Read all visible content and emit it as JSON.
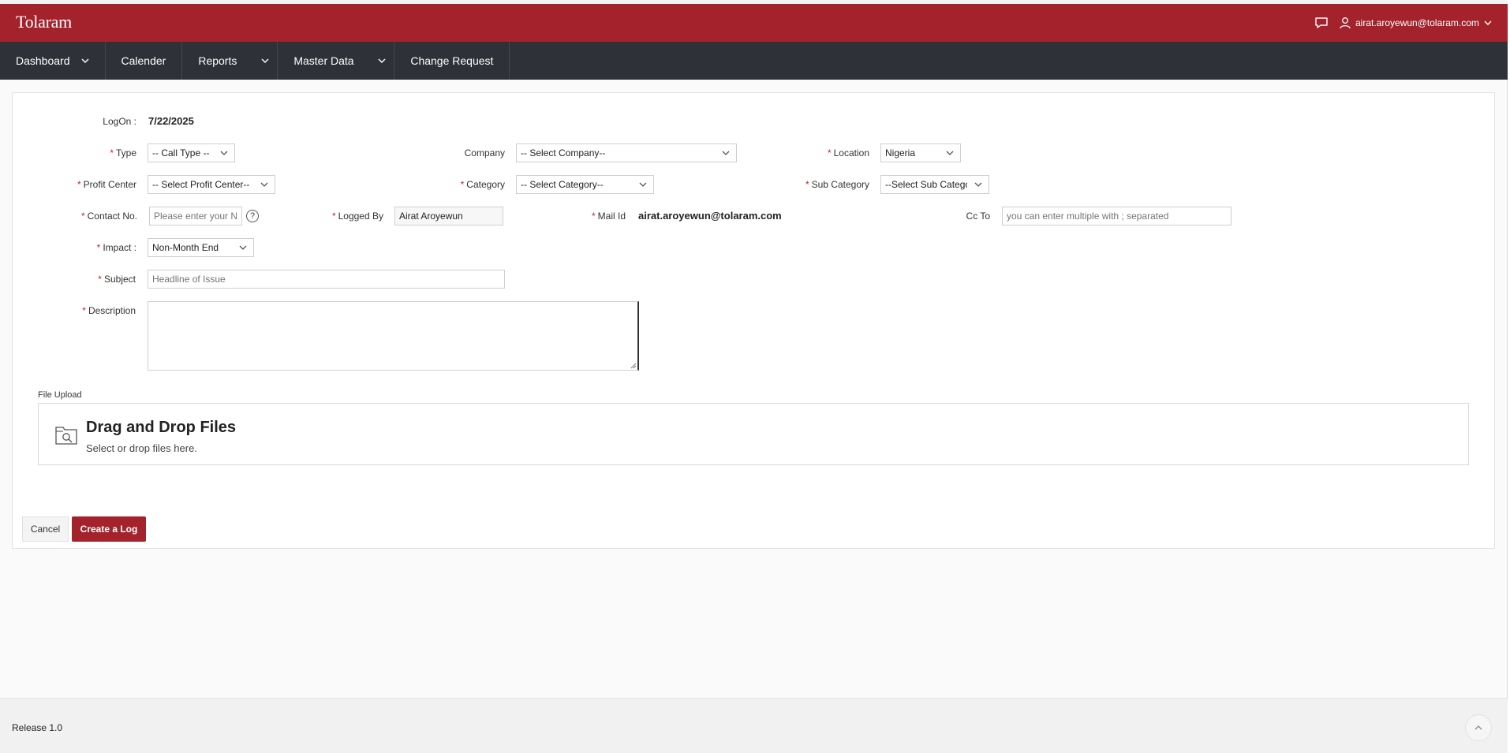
{
  "app": {
    "title": "Tolaram"
  },
  "header": {
    "user_email": "airat.aroyewun@tolaram.com"
  },
  "nav": {
    "items": [
      {
        "label": "Dashboard",
        "has_menu": true
      },
      {
        "label": "Calender",
        "has_menu": false
      },
      {
        "label": "Reports",
        "has_menu": true
      },
      {
        "label": "Master Data",
        "has_menu": true
      },
      {
        "label": "Change Request",
        "has_menu": false
      }
    ]
  },
  "form": {
    "logon": {
      "label": "LogOn :",
      "value": "7/22/2025"
    },
    "type": {
      "label": "Type",
      "value": "-- Call Type --"
    },
    "company": {
      "label": "Company",
      "value": "-- Select Company--"
    },
    "location": {
      "label": "Location",
      "value": "Nigeria"
    },
    "profit_center": {
      "label": "Profit Center",
      "value": "-- Select Profit Center--"
    },
    "category": {
      "label": "Category",
      "value": "-- Select Category--"
    },
    "sub_category": {
      "label": "Sub Category",
      "value": "--Select Sub Category--"
    },
    "contact": {
      "label": "Contact No.",
      "placeholder": "Please enter your Number"
    },
    "logged_by": {
      "label": "Logged By",
      "value": "Airat Aroyewun"
    },
    "mail_id": {
      "label": "Mail Id",
      "value": "airat.aroyewun@tolaram.com"
    },
    "cc_to": {
      "label": "Cc To",
      "placeholder": "you can enter multiple with ; separated"
    },
    "impact": {
      "label": "Impact :",
      "value": "Non-Month End"
    },
    "subject": {
      "label": "Subject",
      "placeholder": "Headline of Issue"
    },
    "description": {
      "label": "Description",
      "value": ""
    },
    "required_marker": "*",
    "help_glyph": "?"
  },
  "upload": {
    "label": "File Upload",
    "title": "Drag and Drop Files",
    "subtitle": "Select or drop files here."
  },
  "actions": {
    "cancel": "Cancel",
    "create": "Create a Log"
  },
  "footer": {
    "release": "Release 1.0"
  },
  "colors": {
    "brand": "#a3222b",
    "nav": "#2e3138",
    "required": "#c0272d"
  },
  "icons": [
    "chat-icon",
    "user-icon",
    "chevron-down-icon",
    "help-icon",
    "folder-search-icon",
    "chevron-up-icon"
  ]
}
